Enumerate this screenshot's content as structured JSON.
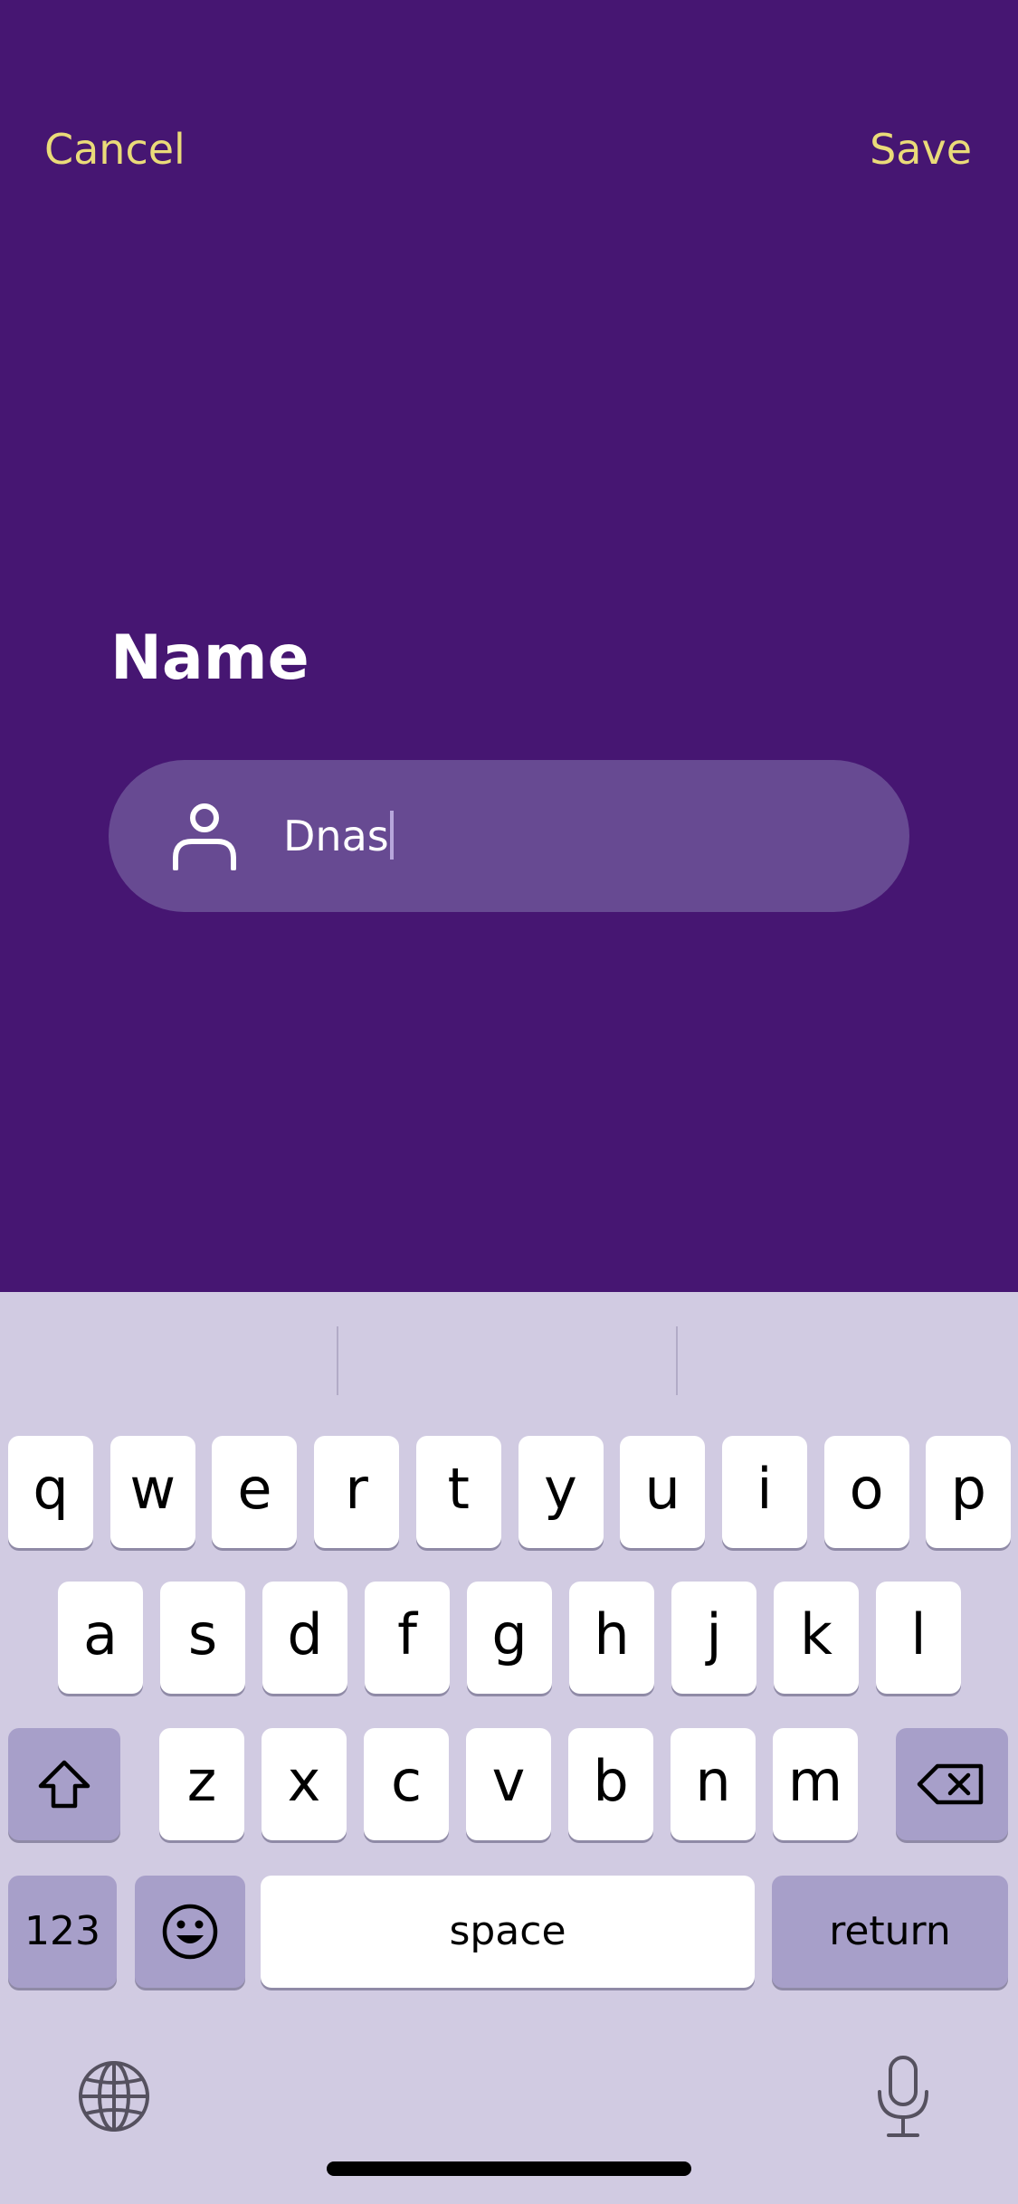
{
  "nav": {
    "cancel_label": "Cancel",
    "save_label": "Save"
  },
  "form": {
    "title": "Name",
    "name_value": "Dnas"
  },
  "keyboard": {
    "row1": [
      "q",
      "w",
      "e",
      "r",
      "t",
      "y",
      "u",
      "i",
      "o",
      "p"
    ],
    "row2": [
      "a",
      "s",
      "d",
      "f",
      "g",
      "h",
      "j",
      "k",
      "l"
    ],
    "row3": [
      "z",
      "x",
      "c",
      "v",
      "b",
      "n",
      "m"
    ],
    "numbers_label": "123",
    "space_label": "space",
    "return_label": "return"
  },
  "colors": {
    "background": "#461672",
    "accent": "#EADB79",
    "field": "#674A92",
    "keyboard_bg": "#D1CBE2",
    "key_dark": "#A79FC9"
  },
  "icons": [
    "person-icon",
    "shift-icon",
    "backspace-icon",
    "emoji-icon",
    "globe-icon",
    "microphone-icon"
  ]
}
